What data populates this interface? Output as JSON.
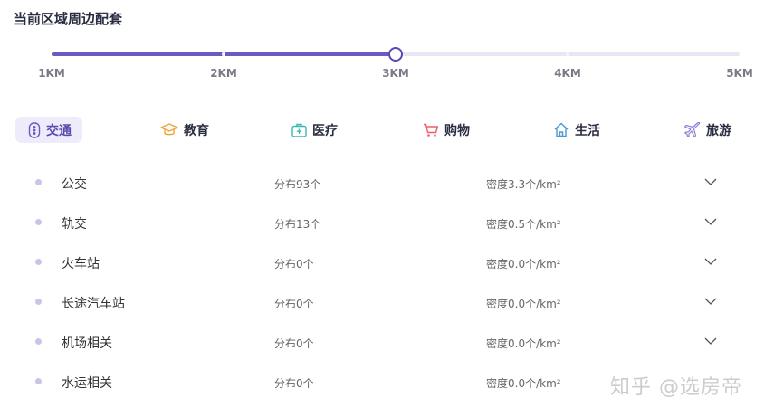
{
  "title": "当前区域周边配套",
  "slider": {
    "ticks": [
      "1KM",
      "2KM",
      "3KM",
      "4KM",
      "5KM"
    ],
    "selected_index": 2,
    "selected_value": "3KM"
  },
  "tabs": [
    {
      "label": "交通",
      "icon": "traffic-light-icon",
      "color": "#6d59c4",
      "active": true
    },
    {
      "label": "教育",
      "icon": "graduation-cap-icon",
      "color": "#f0a431",
      "active": false
    },
    {
      "label": "医疗",
      "icon": "medical-kit-icon",
      "color": "#39b8b0",
      "active": false
    },
    {
      "label": "购物",
      "icon": "shopping-cart-icon",
      "color": "#ef5f67",
      "active": false
    },
    {
      "label": "生活",
      "icon": "house-icon",
      "color": "#4a98d0",
      "active": false
    },
    {
      "label": "旅游",
      "icon": "airplane-icon",
      "color": "#8a80d8",
      "active": false
    }
  ],
  "rows": [
    {
      "name": "公交",
      "count": "分布93个",
      "density": "密度3.3个/km²"
    },
    {
      "name": "轨交",
      "count": "分布13个",
      "density": "密度0.5个/km²"
    },
    {
      "name": "火车站",
      "count": "分布0个",
      "density": "密度0.0个/km²"
    },
    {
      "name": "长途汽车站",
      "count": "分布0个",
      "density": "密度0.0个/km²"
    },
    {
      "name": "机场相关",
      "count": "分布0个",
      "density": "密度0.0个/km²"
    },
    {
      "name": "水运相关",
      "count": "分布0个",
      "density": "密度0.0个/km²"
    }
  ],
  "watermark": "知乎 @选房帝"
}
